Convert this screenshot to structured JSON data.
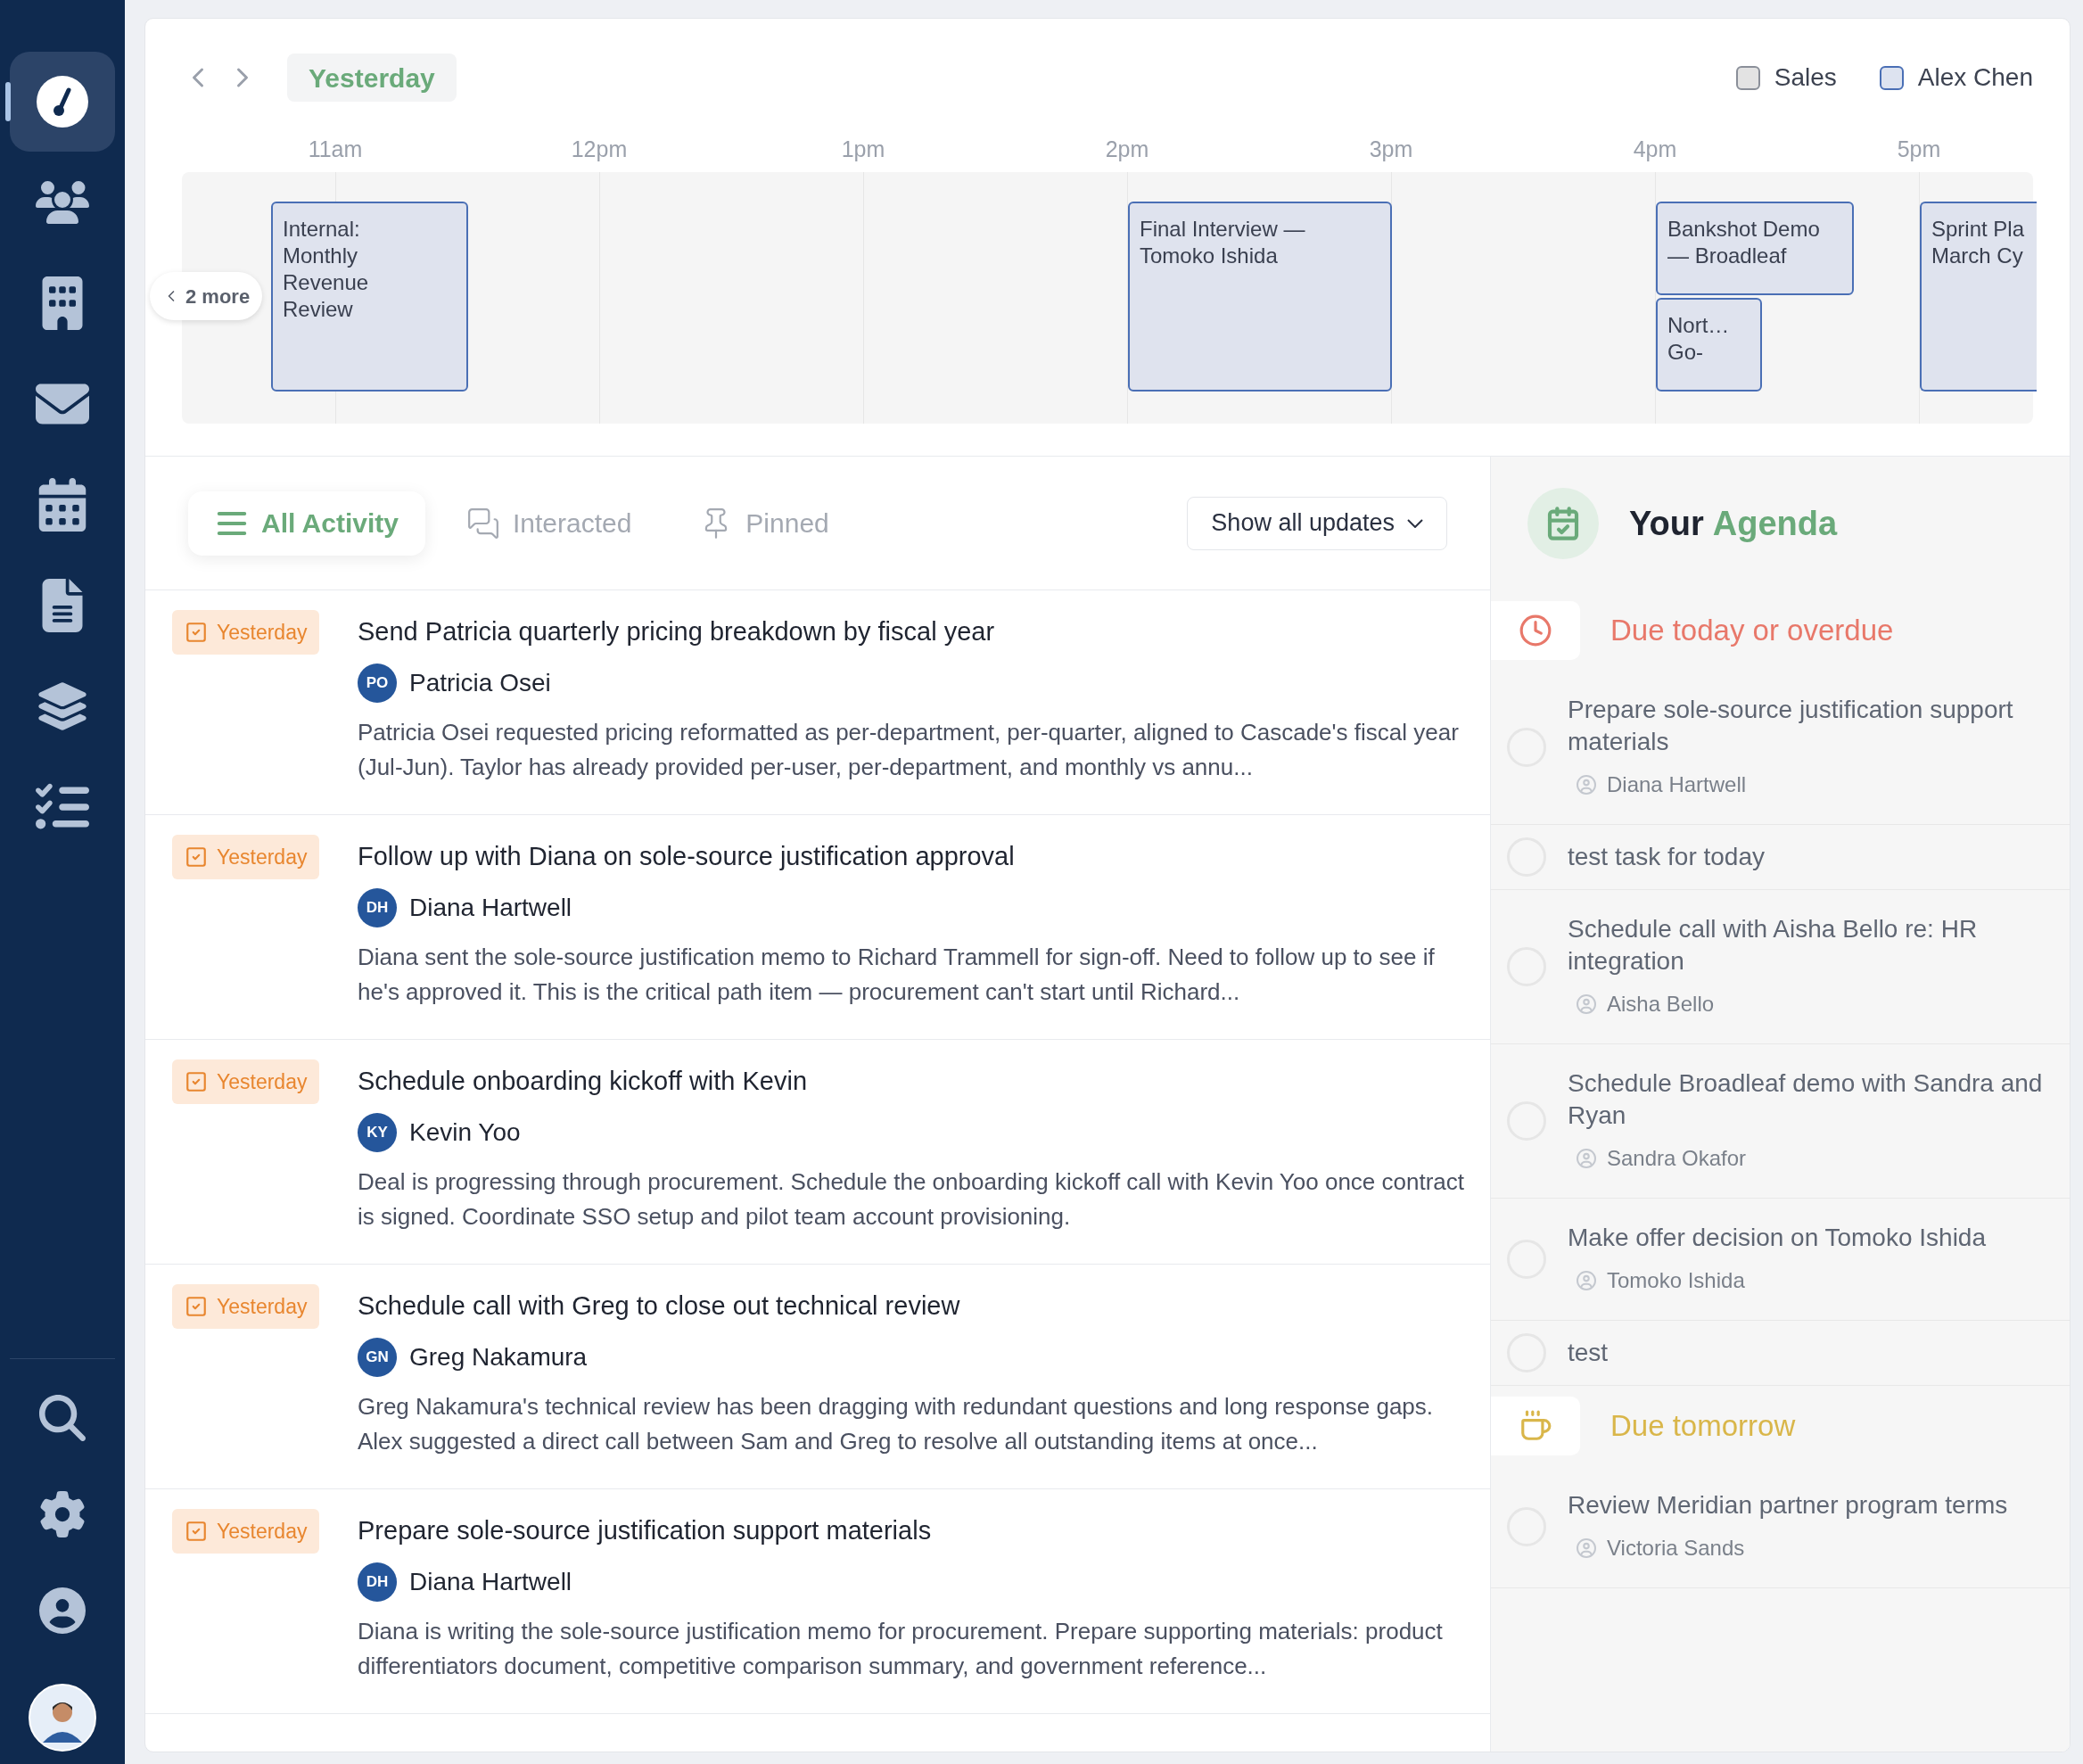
{
  "sidebar": {
    "items": [
      {
        "selected": true
      },
      {
        "selected": false
      },
      {
        "selected": false
      },
      {
        "selected": false
      },
      {
        "selected": false
      },
      {
        "selected": false
      },
      {
        "selected": false
      },
      {
        "selected": false
      }
    ]
  },
  "calendar": {
    "day": "Yesterday",
    "legend": [
      {
        "label": "Sales",
        "color": "#e3e3e3"
      },
      {
        "label": "Alex Chen",
        "color": "#dde3f0"
      }
    ],
    "hours": [
      "11am",
      "12pm",
      "1pm",
      "2pm",
      "3pm",
      "4pm",
      "5pm"
    ],
    "more": "2 more",
    "events": [
      {
        "title": "Internal:\nMonthly\nRevenue\nReview"
      },
      {
        "title": "Final Interview —\nTomoko Ishida"
      },
      {
        "title": "Bankshot Demo\n— Broadleaf"
      },
      {
        "title": "Nort…\nGo-"
      },
      {
        "title": "Sprint Pla\nMarch Cy"
      }
    ]
  },
  "activity": {
    "tabs": [
      {
        "label": "All Activity",
        "selected": true
      },
      {
        "label": "Interacted",
        "selected": false
      },
      {
        "label": "Pinned",
        "selected": false
      }
    ],
    "filter": "Show all updates",
    "items": [
      {
        "badge": "Yesterday",
        "title": "Send Patricia quarterly pricing breakdown by fiscal year",
        "initials": "PO",
        "person": "Patricia Osei",
        "description": "Patricia Osei requested pricing reformatted as per-department, per-quarter, aligned to Cascade's fiscal year (Jul-Jun). Taylor has already provided per-user, per-department, and monthly vs annu..."
      },
      {
        "badge": "Yesterday",
        "title": "Follow up with Diana on sole-source justification approval",
        "initials": "DH",
        "person": "Diana Hartwell",
        "description": "Diana sent the sole-source justification memo to Richard Trammell for sign-off. Need to follow up to see if he's approved it. This is the critical path item — procurement can't start until Richard..."
      },
      {
        "badge": "Yesterday",
        "title": "Schedule onboarding kickoff with Kevin",
        "initials": "KY",
        "person": "Kevin Yoo",
        "description": "Deal is progressing through procurement. Schedule the onboarding kickoff call with Kevin Yoo once contract is signed. Coordinate SSO setup and pilot team account provisioning."
      },
      {
        "badge": "Yesterday",
        "title": "Schedule call with Greg to close out technical review",
        "initials": "GN",
        "person": "Greg Nakamura",
        "description": "Greg Nakamura's technical review has been dragging with redundant questions and long response gaps. Alex suggested a direct call between Sam and Greg to resolve all outstanding items at once..."
      },
      {
        "badge": "Yesterday",
        "title": "Prepare sole-source justification support materials",
        "initials": "DH",
        "person": "Diana Hartwell",
        "description": "Diana is writing the sole-source justification memo for procurement. Prepare supporting materials: product differentiators document, competitive comparison summary, and government reference..."
      }
    ]
  },
  "agenda": {
    "title_prefix": "Your",
    "title_highlight": "Agenda",
    "sections": [
      {
        "kind": "overdue",
        "title": "Due today or overdue",
        "color": "#e8786a",
        "items": [
          {
            "title": "Prepare sole-source justification support materials",
            "person": "Diana Hartwell",
            "checked": false
          },
          {
            "title": "test task for today",
            "checked": false
          },
          {
            "title": "Schedule call with Aisha Bello re: HR integration",
            "person": "Aisha Bello",
            "checked": false
          },
          {
            "title": "Schedule Broadleaf demo with Sandra and Ryan",
            "person": "Sandra Okafor",
            "checked": false
          },
          {
            "title": "Make offer decision on Tomoko Ishida",
            "person": "Tomoko Ishida",
            "checked": false
          },
          {
            "title": "test",
            "checked": false
          }
        ]
      },
      {
        "kind": "tomorrow",
        "title": "Due tomorrow",
        "color": "#d9b64a",
        "items": [
          {
            "title": "Review Meridian partner program terms",
            "person": "Victoria Sands",
            "checked": false
          }
        ]
      }
    ]
  }
}
